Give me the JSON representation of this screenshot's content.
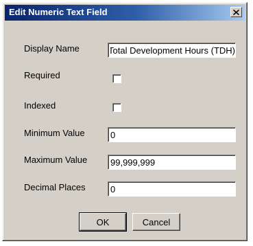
{
  "dialog": {
    "title": "Edit Numeric Text Field",
    "close_symbol": "close-icon"
  },
  "fields": {
    "display_name": {
      "label": "Display Name",
      "value": "Total Development Hours (TDH)"
    },
    "required": {
      "label": "Required",
      "checked": false
    },
    "indexed": {
      "label": "Indexed",
      "checked": false
    },
    "minimum_value": {
      "label": "Minimum Value",
      "value": "0"
    },
    "maximum_value": {
      "label": "Maximum Value",
      "value": "99,999,999"
    },
    "decimal_places": {
      "label": "Decimal Places",
      "value": "0"
    }
  },
  "buttons": {
    "ok_label": "OK",
    "cancel_label": "Cancel"
  },
  "colors": {
    "titlebar_start": "#0a246a",
    "titlebar_end": "#a6caf0",
    "dialog_face": "#d4d0c8"
  }
}
